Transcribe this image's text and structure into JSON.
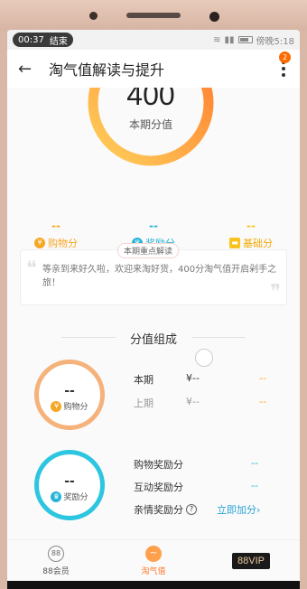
{
  "status_bar": {
    "time": "00:37",
    "end_label": "结束",
    "battery_text": "傍晚5:18"
  },
  "header": {
    "title": "淘气值解读与提升",
    "badge_count": "2"
  },
  "gauge": {
    "score": "400",
    "label": "本期分值",
    "progress": 0.83,
    "color_start": "#ffd05a",
    "color_end": "#ff7a2f"
  },
  "categories": [
    {
      "value": "--",
      "label": "购物分",
      "icon": "coin-icon",
      "color": "#f5a623"
    },
    {
      "value": "--",
      "label": "奖励分",
      "icon": "trophy-icon",
      "color": "#26b4d6"
    },
    {
      "value": "--",
      "label": "基础分",
      "icon": "card-icon",
      "color": "#f7c31c"
    }
  ],
  "highlight": {
    "tag": "本期重点解读",
    "text": "等亲到来好久啦，欢迎来淘好货，400分淘气值开启剁手之旅！"
  },
  "composition": {
    "title": "分值组成",
    "shopping": {
      "ring_value": "--",
      "ring_label": "购物分",
      "rows": [
        {
          "k": "本期",
          "v": "¥--",
          "d": "--"
        },
        {
          "k": "上期",
          "v": "¥--",
          "d": "--"
        }
      ]
    },
    "reward": {
      "ring_value": "--",
      "ring_label": "奖励分",
      "rows": [
        {
          "k": "购物奖励分",
          "d": "--"
        },
        {
          "k": "互动奖励分",
          "d": "--"
        },
        {
          "k": "亲情奖励分",
          "link": "立即加分"
        }
      ]
    }
  },
  "tabs": [
    {
      "label": "88会员",
      "icon_text": "88"
    },
    {
      "label": "淘气值",
      "icon_text": "~"
    },
    {
      "label": "88VIP"
    }
  ]
}
